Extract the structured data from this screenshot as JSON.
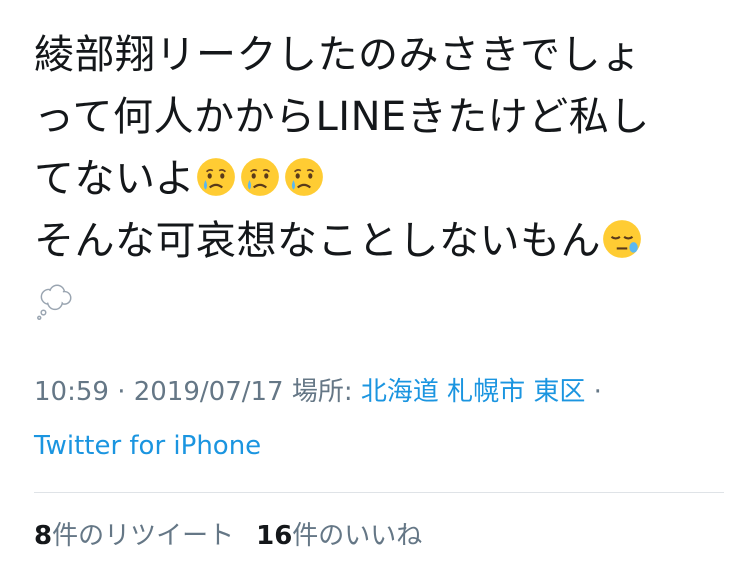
{
  "tweet": {
    "line1": "綾部翔リークしたのみさきでしょ",
    "line2": "って何人かからLINEきたけど私し",
    "line3": "てないよ",
    "line4": "そんな可哀想なことしないもん",
    "emojis": [
      "crying-face",
      "crying-face",
      "crying-face",
      "sleepy-face",
      "thought-balloon"
    ]
  },
  "meta": {
    "time": "10:59",
    "sep1": " · ",
    "date": "2019/07/17",
    "location_label": " 場所: ",
    "location": "北海道 札幌市 東区",
    "sep2": " ·",
    "source": "Twitter for iPhone"
  },
  "stats": {
    "retweet_count": "8",
    "retweet_label": "件のリツイート",
    "like_count": "16",
    "like_label": "件のいいね"
  }
}
